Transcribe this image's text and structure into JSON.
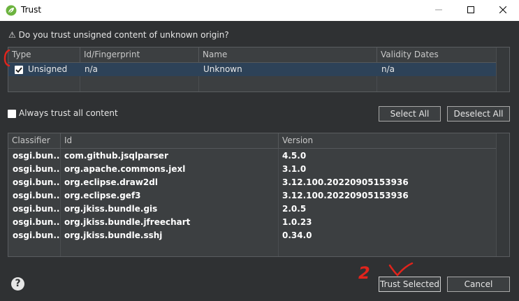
{
  "window": {
    "title": "Trust",
    "controls": {
      "minimize": "minimize-icon",
      "maximize": "maximize-icon",
      "close": "close-icon"
    }
  },
  "question": "⚠ Do you trust unsigned content of unknown origin?",
  "trust_table": {
    "columns": [
      "Type",
      "Id/Fingerprint",
      "Name",
      "Validity Dates"
    ],
    "rows": [
      {
        "checked": true,
        "type": "Unsigned",
        "id": "n/a",
        "name": "Unknown",
        "validity": "n/a"
      }
    ]
  },
  "always_trust": {
    "label": "Always trust all content",
    "checked": false
  },
  "buttons": {
    "select_all": "Select All",
    "deselect_all": "Deselect All",
    "trust_selected": "Trust Selected",
    "cancel": "Cancel"
  },
  "bundle_table": {
    "columns": [
      "Classifier",
      "Id",
      "Version"
    ],
    "rows": [
      {
        "classifier": "osgi.bun...",
        "id": "com.github.jsqlparser",
        "version": "4.5.0"
      },
      {
        "classifier": "osgi.bun...",
        "id": "org.apache.commons.jexl",
        "version": "3.1.0"
      },
      {
        "classifier": "osgi.bun...",
        "id": "org.eclipse.draw2dl",
        "version": "3.12.100.20220905153936"
      },
      {
        "classifier": "osgi.bun...",
        "id": "org.eclipse.gef3",
        "version": "3.12.100.20220905153936"
      },
      {
        "classifier": "osgi.bun...",
        "id": "org.jkiss.bundle.gis",
        "version": "2.0.5"
      },
      {
        "classifier": "osgi.bun...",
        "id": "org.jkiss.bundle.jfreechart",
        "version": "1.0.23"
      },
      {
        "classifier": "osgi.bun...",
        "id": "org.jkiss.bundle.sshj",
        "version": "0.34.0"
      }
    ]
  },
  "annotations": {
    "step_number": "2",
    "color": "#e0241c"
  },
  "help": "?",
  "colors": {
    "background": "#2f3133",
    "selection": "#2d4258",
    "annotation": "#e0241c"
  }
}
